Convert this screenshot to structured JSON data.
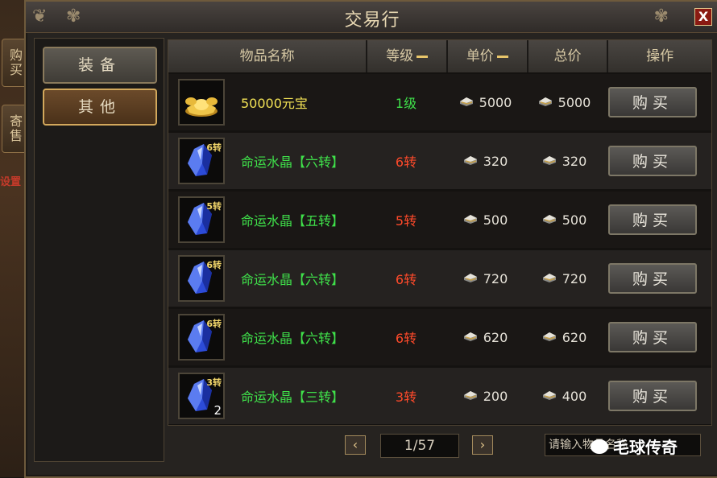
{
  "window": {
    "title": "交易行",
    "close_label": "X"
  },
  "side_tabs": [
    "购买",
    "寄售"
  ],
  "background_fragments": [
    "设置"
  ],
  "categories": [
    {
      "label": "装备",
      "active": false
    },
    {
      "label": "其他",
      "active": true
    }
  ],
  "table": {
    "headers": [
      "物品名称",
      "等级",
      "单价",
      "总价",
      "操作"
    ],
    "sortable": [
      false,
      true,
      true,
      false,
      false
    ],
    "rows": [
      {
        "icon": "gold-ingot-icon",
        "name": "50000元宝",
        "name_color": "#f2e255",
        "level": "1级",
        "level_color": "#3fe04a",
        "unit_price": "5000",
        "total_price": "5000",
        "turn": "",
        "count": "",
        "action": "购买"
      },
      {
        "icon": "blue-crystal-icon",
        "name": "命运水晶【六转】",
        "name_color": "#3fe04a",
        "level": "6转",
        "level_color": "#ff4a2a",
        "unit_price": "320",
        "total_price": "320",
        "turn": "6转",
        "count": "",
        "action": "购买"
      },
      {
        "icon": "blue-crystal-icon",
        "name": "命运水晶【五转】",
        "name_color": "#3fe04a",
        "level": "5转",
        "level_color": "#ff4a2a",
        "unit_price": "500",
        "total_price": "500",
        "turn": "5转",
        "count": "",
        "action": "购买"
      },
      {
        "icon": "blue-crystal-icon",
        "name": "命运水晶【六转】",
        "name_color": "#3fe04a",
        "level": "6转",
        "level_color": "#ff4a2a",
        "unit_price": "720",
        "total_price": "720",
        "turn": "6转",
        "count": "",
        "action": "购买"
      },
      {
        "icon": "blue-crystal-icon",
        "name": "命运水晶【六转】",
        "name_color": "#3fe04a",
        "level": "6转",
        "level_color": "#ff4a2a",
        "unit_price": "620",
        "total_price": "620",
        "turn": "6转",
        "count": "",
        "action": "购买"
      },
      {
        "icon": "blue-crystal-icon",
        "name": "命运水晶【三转】",
        "name_color": "#3fe04a",
        "level": "3转",
        "level_color": "#ff4a2a",
        "unit_price": "200",
        "total_price": "400",
        "turn": "3转",
        "count": "2",
        "action": "购买"
      }
    ]
  },
  "pager": {
    "prev": "‹",
    "next": "›",
    "page_text": "1/57"
  },
  "search": {
    "placeholder": "请输入物品名称"
  },
  "watermark": {
    "text": "毛球传奇"
  },
  "colors": {
    "accent_gold": "#d2a85c",
    "window_bg": "#262320"
  }
}
